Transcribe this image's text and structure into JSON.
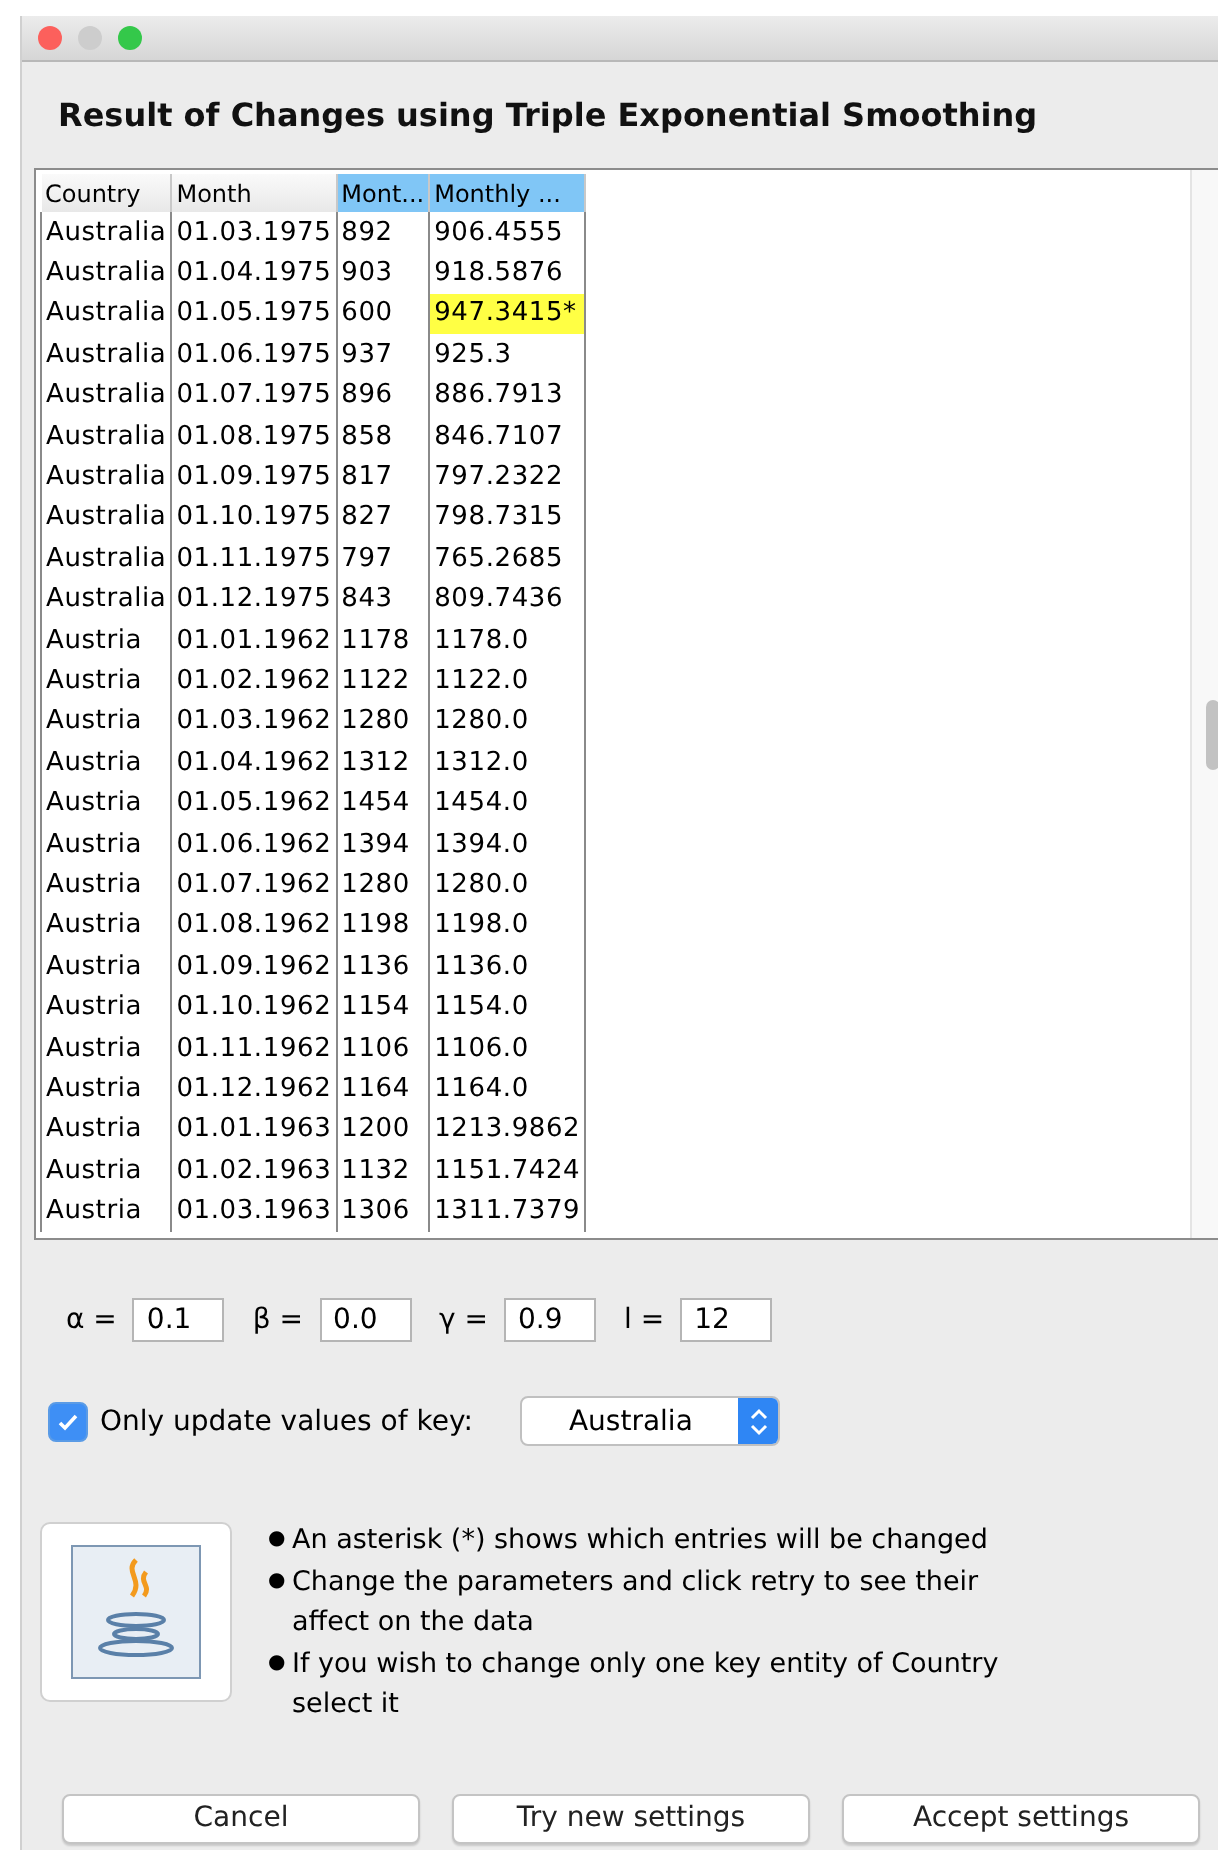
{
  "window": {
    "title": "Result of Changes using Triple Exponential Smoothing"
  },
  "table": {
    "columns": [
      {
        "label": "Country",
        "selected": false
      },
      {
        "label": "Month",
        "selected": false
      },
      {
        "label": "Mont...",
        "selected": true
      },
      {
        "label": "Monthly ...",
        "selected": true
      }
    ],
    "rows": [
      {
        "cells": [
          "Australia",
          "01.03.1975",
          "892",
          "906.4555"
        ],
        "changed": false
      },
      {
        "cells": [
          "Australia",
          "01.04.1975",
          "903",
          "918.5876"
        ],
        "changed": false
      },
      {
        "cells": [
          "Australia",
          "01.05.1975",
          "600",
          "947.3415*"
        ],
        "changed": true
      },
      {
        "cells": [
          "Australia",
          "01.06.1975",
          "937",
          "925.3"
        ],
        "changed": false
      },
      {
        "cells": [
          "Australia",
          "01.07.1975",
          "896",
          "886.7913"
        ],
        "changed": false
      },
      {
        "cells": [
          "Australia",
          "01.08.1975",
          "858",
          "846.7107"
        ],
        "changed": false
      },
      {
        "cells": [
          "Australia",
          "01.09.1975",
          "817",
          "797.2322"
        ],
        "changed": false
      },
      {
        "cells": [
          "Australia",
          "01.10.1975",
          "827",
          "798.7315"
        ],
        "changed": false
      },
      {
        "cells": [
          "Australia",
          "01.11.1975",
          "797",
          "765.2685"
        ],
        "changed": false
      },
      {
        "cells": [
          "Australia",
          "01.12.1975",
          "843",
          "809.7436"
        ],
        "changed": false
      },
      {
        "cells": [
          "Austria",
          "01.01.1962",
          "1178",
          "1178.0"
        ],
        "changed": false
      },
      {
        "cells": [
          "Austria",
          "01.02.1962",
          "1122",
          "1122.0"
        ],
        "changed": false
      },
      {
        "cells": [
          "Austria",
          "01.03.1962",
          "1280",
          "1280.0"
        ],
        "changed": false
      },
      {
        "cells": [
          "Austria",
          "01.04.1962",
          "1312",
          "1312.0"
        ],
        "changed": false
      },
      {
        "cells": [
          "Austria",
          "01.05.1962",
          "1454",
          "1454.0"
        ],
        "changed": false
      },
      {
        "cells": [
          "Austria",
          "01.06.1962",
          "1394",
          "1394.0"
        ],
        "changed": false
      },
      {
        "cells": [
          "Austria",
          "01.07.1962",
          "1280",
          "1280.0"
        ],
        "changed": false
      },
      {
        "cells": [
          "Austria",
          "01.08.1962",
          "1198",
          "1198.0"
        ],
        "changed": false
      },
      {
        "cells": [
          "Austria",
          "01.09.1962",
          "1136",
          "1136.0"
        ],
        "changed": false
      },
      {
        "cells": [
          "Austria",
          "01.10.1962",
          "1154",
          "1154.0"
        ],
        "changed": false
      },
      {
        "cells": [
          "Austria",
          "01.11.1962",
          "1106",
          "1106.0"
        ],
        "changed": false
      },
      {
        "cells": [
          "Austria",
          "01.12.1962",
          "1164",
          "1164.0"
        ],
        "changed": false
      },
      {
        "cells": [
          "Austria",
          "01.01.1963",
          "1200",
          "1213.9862"
        ],
        "changed": false
      },
      {
        "cells": [
          "Austria",
          "01.02.1963",
          "1132",
          "1151.7424"
        ],
        "changed": false
      },
      {
        "cells": [
          "Austria",
          "01.03.1963",
          "1306",
          "1311.7379"
        ],
        "changed": false
      }
    ]
  },
  "parameters": [
    {
      "label": "α =",
      "value": "0.1"
    },
    {
      "label": "β =",
      "value": "0.0"
    },
    {
      "label": "γ =",
      "value": "0.9"
    },
    {
      "label": "l =",
      "value": "12"
    }
  ],
  "key_filter": {
    "label": "Only update values of key:",
    "checked": true,
    "value": "Australia"
  },
  "notes": [
    {
      "bullet": "●",
      "text": "An asterisk (*) shows which entries will be changed"
    },
    {
      "bullet": "●",
      "text": "Change the parameters and click retry to see their affect on the data"
    },
    {
      "bullet": "●",
      "text": "If you wish to change only one key entity of Country select it"
    }
  ],
  "buttons": [
    "Cancel",
    "Try new settings",
    "Accept settings"
  ]
}
